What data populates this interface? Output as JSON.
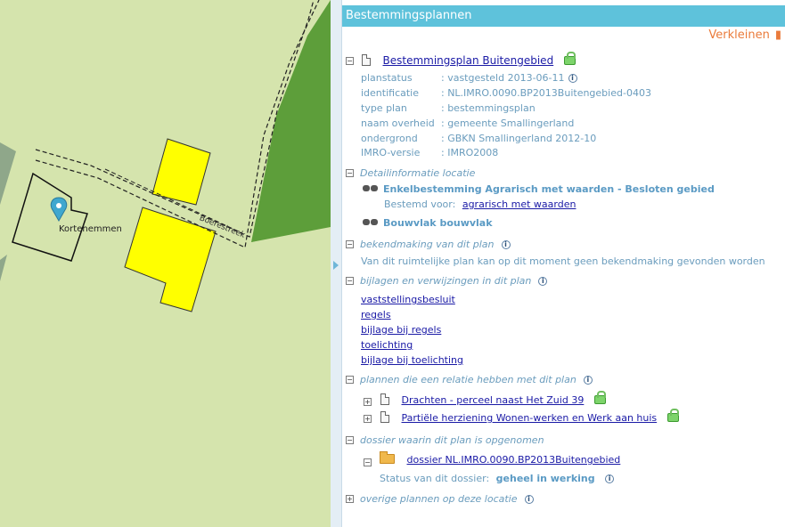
{
  "map": {
    "place_label": "Kortehemmen",
    "road_label": "Boerestreek"
  },
  "panel": {
    "title": "Bestemmingsplannen",
    "collapse_label": "Verkleinen",
    "plan": {
      "toggle": "−",
      "name": "Bestemmingsplan Buitengebied",
      "fields": [
        {
          "label": "planstatus",
          "value": ": vastgesteld 2013-06-11",
          "info": true
        },
        {
          "label": "identificatie",
          "value": ": NL.IMRO.0090.BP2013Buitengebied-0403",
          "info": false
        },
        {
          "label": "type plan",
          "value": ": bestemmingsplan",
          "info": false
        },
        {
          "label": "naam overheid",
          "value": ": gemeente Smallingerland",
          "info": false
        },
        {
          "label": "ondergrond",
          "value": ": GBKN Smallingerland 2012-10",
          "info": false
        },
        {
          "label": "IMRO-versie",
          "value": ": IMRO2008",
          "info": false
        }
      ]
    },
    "detail": {
      "title": "Detailinformatie locatie",
      "items": [
        {
          "title": "Enkelbestemming Agrarisch met waarden - Besloten gebied",
          "sub_label": "Bestemd voor:",
          "sub_link": "agrarisch met waarden"
        },
        {
          "title": "Bouwvlak bouwvlak"
        }
      ]
    },
    "bekendmaking": {
      "title": "bekendmaking van dit plan",
      "text": "Van dit ruimtelijke plan kan op dit moment geen bekendmaking gevonden worden"
    },
    "bijlagen": {
      "title": "bijlagen en verwijzingen in dit plan",
      "links": [
        "vaststellingsbesluit",
        "regels",
        "bijlage bij regels",
        "toelichting",
        "bijlage bij toelichting"
      ]
    },
    "related": {
      "title": "plannen die een relatie hebben met dit plan",
      "plans": [
        "Drachten - perceel naast Het Zuid 39",
        "Partiële herziening Wonen-werken en Werk aan huis"
      ]
    },
    "dossier": {
      "title": "dossier waarin dit plan is opgenomen",
      "name": "dossier NL.IMRO.0090.BP2013Buitengebied",
      "status_label": "Status van dit dossier:",
      "status_value": "geheel in werking"
    },
    "overige": {
      "title": "overige plannen op deze locatie"
    }
  },
  "colors": {
    "header": "#5ec2db",
    "map_background": "#d5e4ad",
    "parcel_yellow": "#ffff00",
    "forest_green": "#5d9e3a",
    "accent_orange": "#ea7b3b"
  }
}
